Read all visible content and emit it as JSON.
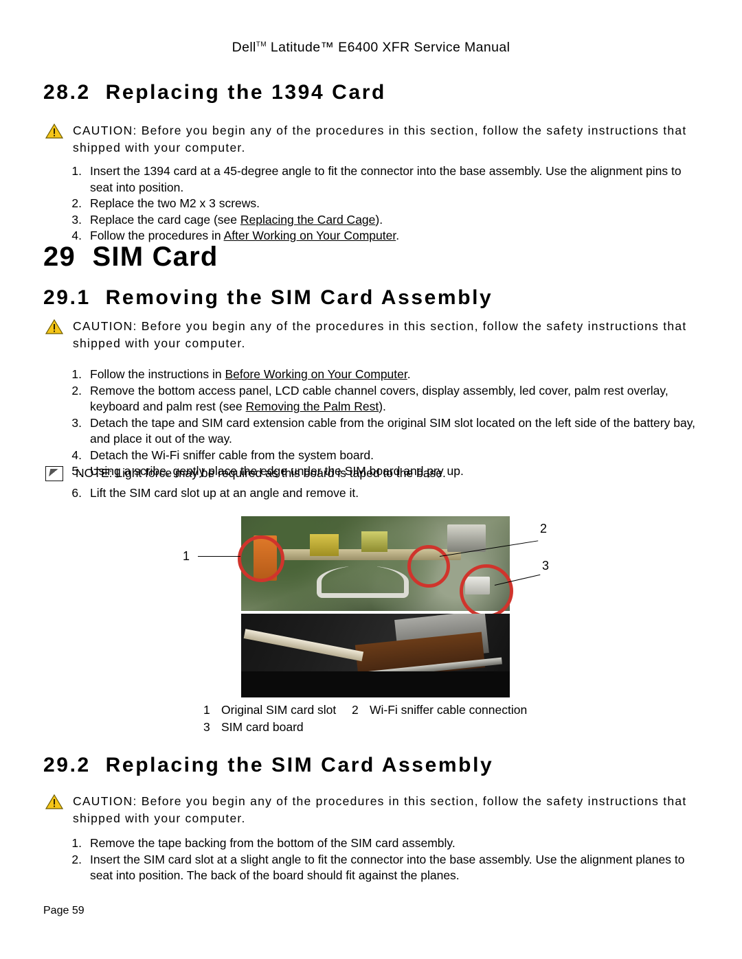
{
  "document": {
    "header_prefix": "Dell",
    "header_tm1": "TM",
    "header_mid": " Latitude™ E6400 XFR Service Manual",
    "page_label": "Page 59"
  },
  "sections": [
    {
      "number": "28.2",
      "title": "Replacing the 1394 Card",
      "caution": "CAUTION: Before you begin any of the procedures in this section, follow the safety instructions that shipped with your computer.",
      "steps": [
        "Insert the 1394 card at a 45-degree angle to fit the connector into the base assembly. Use the alignment pins to seat into position.",
        "Replace the two M2 x 3 screws.",
        "Replace the card cage (see Replacing the Card Cage).",
        "Follow the procedures in After Working on Your Computer."
      ]
    }
  ],
  "chapter": {
    "number": "29",
    "title": "SIM Card"
  },
  "section_29_1": {
    "number": "29.1",
    "title": "Removing the SIM Card Assembly",
    "caution": "CAUTION: Before you begin any of the procedures in this section, follow the safety instructions that shipped with your computer.",
    "steps_before_note": [
      "Follow the instructions in Before Working on Your Computer.",
      "Remove the bottom access panel, LCD cable channel covers, display assembly, led cover, palm rest overlay, keyboard and palm rest (see Removing the Palm Rest).",
      "Detach the tape and SIM card extension cable from the original SIM slot located on the left side of the battery bay, and place it out of the way.",
      "Detach the Wi-Fi sniffer cable from the system board.",
      "Using a scribe, gently place the edge under the SIM board and pry up."
    ],
    "note": "NOTE: Light force may be required as this board is taped to the base.",
    "step_after_note": "Lift the SIM card slot up at an angle and remove it.",
    "figure": {
      "callouts": [
        {
          "id": "1",
          "label": "Original SIM card slot"
        },
        {
          "id": "2",
          "label": "Wi-Fi sniffer cable connection"
        },
        {
          "id": "3",
          "label": "SIM card board"
        }
      ]
    }
  },
  "section_29_2": {
    "number": "29.2",
    "title": "Replacing the SIM Card Assembly",
    "caution": "CAUTION: Before you begin any of the procedures in this section, follow the safety instructions that shipped with your computer.",
    "steps": [
      "Remove the tape backing from the bottom of the SIM card assembly.",
      "Insert the SIM card slot at a slight angle to fit the connector into the base assembly. Use the alignment planes to seat into position. The back of the board should fit against the planes."
    ]
  },
  "colors": {
    "caution_triangle": "#f5c518",
    "highlight_circle": "#d0342c"
  }
}
